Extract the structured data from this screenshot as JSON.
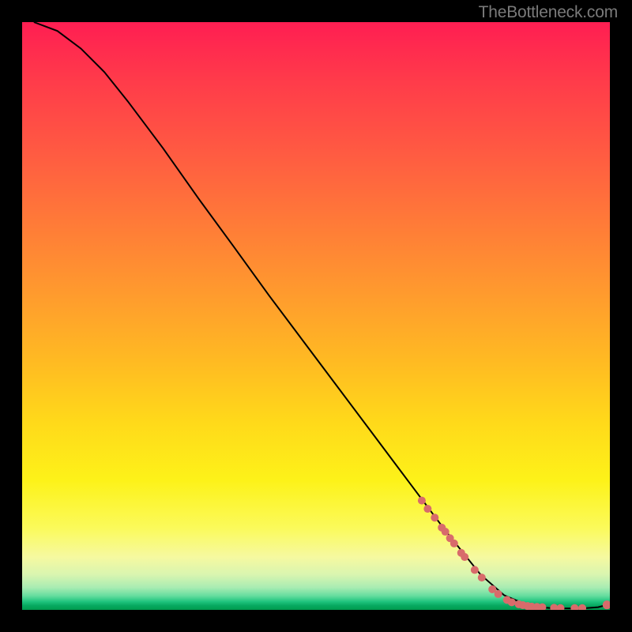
{
  "attribution": "TheBottleneck.com",
  "colors": {
    "dot": "#d86b6b",
    "curve": "#000000"
  },
  "chart_data": {
    "type": "line",
    "title": "",
    "xlabel": "",
    "ylabel": "",
    "xlim": [
      0,
      100
    ],
    "ylim": [
      0,
      100
    ],
    "annotations": [
      "TheBottleneck.com"
    ],
    "grid": false,
    "series": [
      {
        "name": "curve",
        "x": [
          2,
          6,
          10,
          14,
          18,
          24,
          30,
          36,
          42,
          48,
          54,
          60,
          66,
          72,
          78,
          82,
          86,
          88,
          90,
          92,
          94,
          96,
          98,
          99.5
        ],
        "y": [
          100,
          98.5,
          95.5,
          91.5,
          86.5,
          78.5,
          70,
          61.8,
          53.5,
          45.5,
          37.5,
          29.5,
          21.5,
          13.5,
          6.0,
          2.5,
          0.8,
          0.45,
          0.3,
          0.25,
          0.25,
          0.3,
          0.45,
          0.85
        ]
      }
    ],
    "scatter_points": {
      "name": "highlighted-dots",
      "x": [
        68,
        69,
        70.2,
        71.4,
        72,
        72.8,
        73.5,
        74.7,
        75.3,
        77,
        78.2,
        80,
        81,
        82.5,
        83.3,
        84.5,
        85.2,
        86,
        86.7,
        87.6,
        88.5,
        90.5,
        91.6,
        94,
        95.3,
        99.5
      ],
      "y": [
        18.6,
        17.2,
        15.7,
        14.0,
        13.3,
        12.2,
        11.3,
        9.7,
        9.0,
        6.8,
        5.5,
        3.5,
        2.7,
        1.7,
        1.3,
        0.95,
        0.8,
        0.65,
        0.55,
        0.5,
        0.45,
        0.35,
        0.3,
        0.3,
        0.3,
        0.85
      ],
      "radius": [
        5,
        5,
        5,
        5,
        5,
        5,
        5,
        5,
        5,
        5,
        5,
        5,
        5,
        5,
        5,
        5,
        5,
        5,
        5,
        5,
        5,
        5,
        5,
        5,
        5,
        5.5
      ]
    }
  }
}
